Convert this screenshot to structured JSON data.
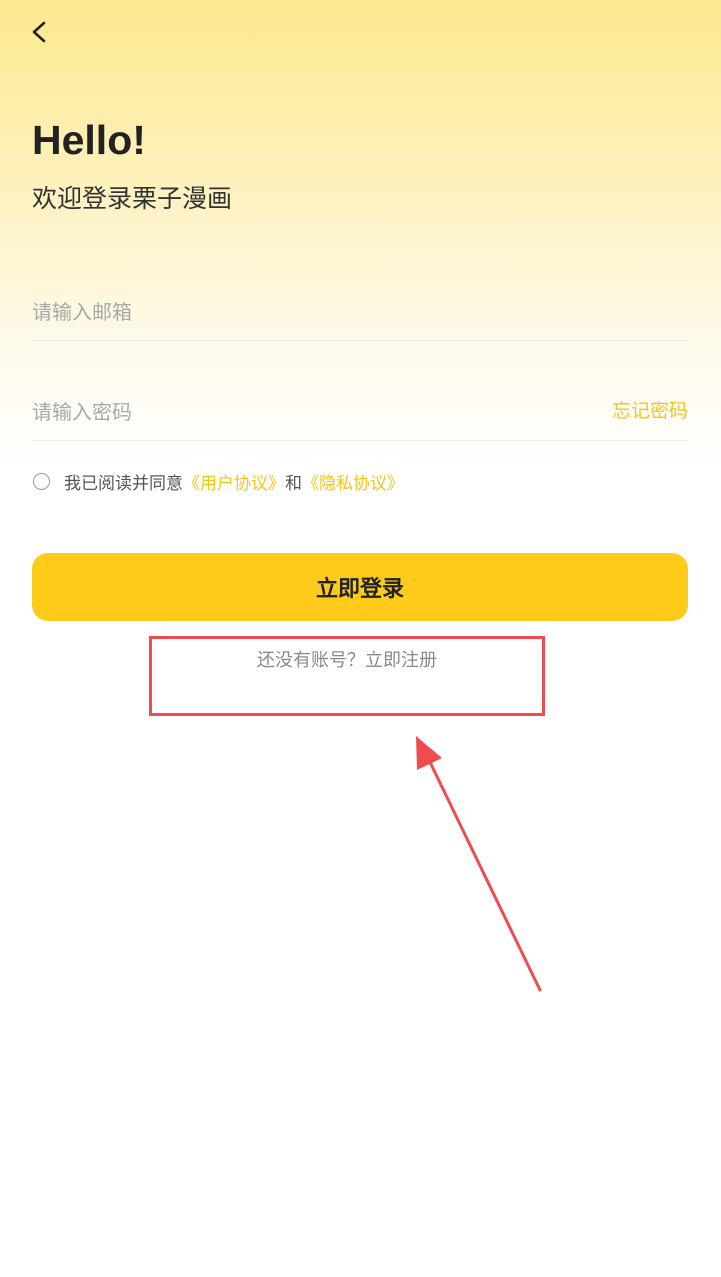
{
  "header": {
    "back_icon": "chevron-left-icon"
  },
  "greeting": {
    "title": "Hello!",
    "subtitle": "欢迎登录栗子漫画"
  },
  "form": {
    "email_placeholder": "请输入邮箱",
    "email_value": "",
    "password_placeholder": "请输入密码",
    "password_value": "",
    "forgot_password_label": "忘记密码",
    "agreement": {
      "checked": false,
      "prefix": "我已阅读并同意",
      "user_agreement": "《用户协议》",
      "conjunction": "和",
      "privacy_policy": "《隐私协议》"
    },
    "login_label": "立即登录",
    "register_prompt": "还没有账号？立即注册"
  },
  "colors": {
    "accent": "#fecb1a",
    "link": "#f7c41a",
    "annotation": "#ee4c50",
    "header_gradient_top": "#fde98f"
  }
}
